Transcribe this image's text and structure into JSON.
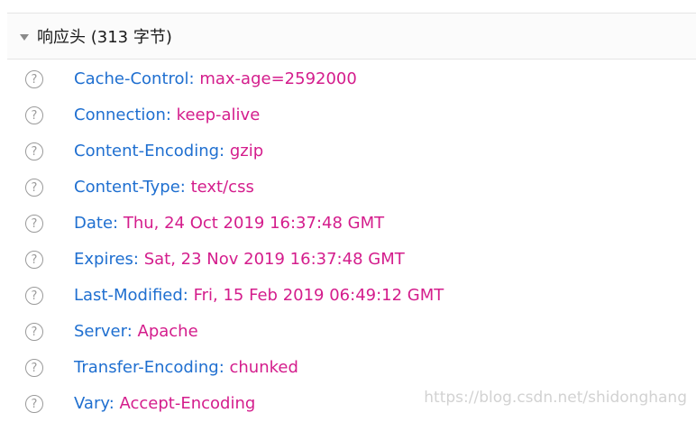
{
  "section": {
    "title": "响应头 (313 字节)"
  },
  "icon": {
    "help_glyph": "?"
  },
  "headers": [
    {
      "name": "Cache-Control",
      "value": "max-age=2592000"
    },
    {
      "name": "Connection",
      "value": "keep-alive"
    },
    {
      "name": "Content-Encoding",
      "value": "gzip"
    },
    {
      "name": "Content-Type",
      "value": "text/css"
    },
    {
      "name": "Date",
      "value": "Thu, 24 Oct 2019 16:37:48 GMT"
    },
    {
      "name": "Expires",
      "value": "Sat, 23 Nov 2019 16:37:48 GMT"
    },
    {
      "name": "Last-Modified",
      "value": "Fri, 15 Feb 2019 06:49:12 GMT"
    },
    {
      "name": "Server",
      "value": "Apache"
    },
    {
      "name": "Transfer-Encoding",
      "value": "chunked"
    },
    {
      "name": "Vary",
      "value": "Accept-Encoding"
    }
  ],
  "watermark": "https://blog.csdn.net/shidonghang",
  "colors": {
    "header_name": "#1f6fd0",
    "header_value": "#d41d8c"
  }
}
